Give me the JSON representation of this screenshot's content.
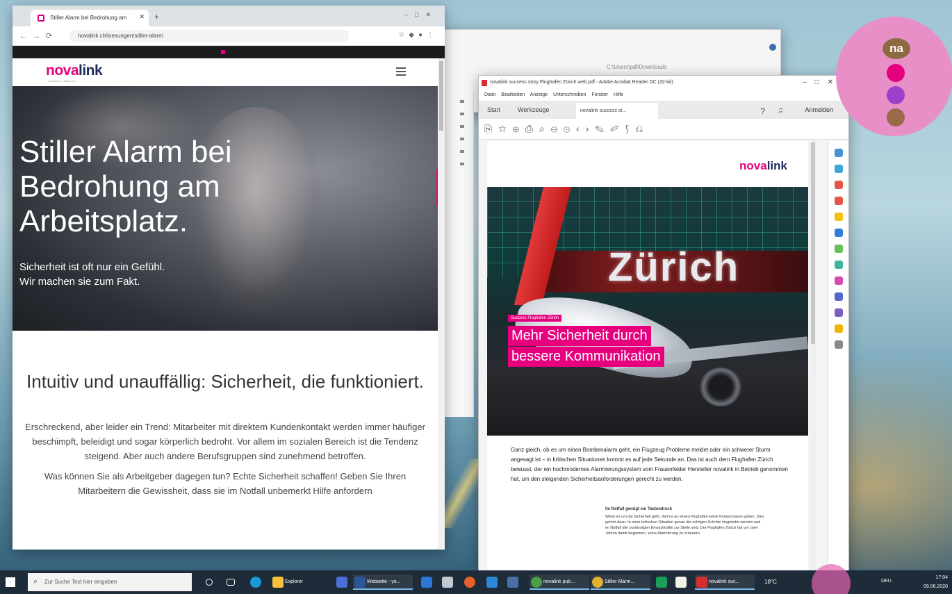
{
  "bg_window": {
    "address": "C:\\Users\\pdf\\Downloads"
  },
  "browser": {
    "tab_title": "Stiller Alarm bei Bedrohung am",
    "url": "novalink.ch/loesungen/stiller-alarm",
    "logo_nova": "nova",
    "logo_link": "link",
    "logo_sub": "Kommunikation",
    "hero_title": "Stiller Alarm bei Bedrohung am Arbeitsplatz.",
    "hero_tagline_1": "Sicherheit ist oft nur ein Gefühl.",
    "hero_tagline_2": "Wir machen sie zum Fakt.",
    "section_heading": "Intuitiv und unauffällig: Sicherheit, die funktioniert.",
    "para_1": "Erschreckend, aber leider ein Trend: Mitarbeiter mit direktem Kundenkontakt werden immer häufiger beschimpft, beleidigt und sogar körperlich bedroht. Vor allem im sozialen Bereich ist die Tendenz steigend. Aber auch andere Berufsgruppen sind zunehmend betroffen.",
    "para_2": "Was können Sie als Arbeitgeber dagegen tun? Echte Sicherheit schaffen! Geben Sie Ihren Mitarbeitern die Gewissheit, dass sie im Notfall unbemerkt Hilfe anfordern"
  },
  "pdf": {
    "window_title": "novalink success story Flughafen Zürich web.pdf - Adobe Acrobat Reader DC (32-bit)",
    "menu": "Datei Bearbeiten Anzeige Unterschreiben Fenster Hilfe",
    "tab_start": "Start",
    "tab_tools": "Werkzeuge",
    "tab_doc": "novalink success st...",
    "signin": "Anmelden",
    "logo_nova": "nova",
    "logo_link": "link",
    "photo_text": "Zürich",
    "kicker": "Success Flughafen Zürich",
    "headline_1": "Mehr Sicherheit durch",
    "headline_2": "bessere Kommunikation",
    "body": "Ganz gleich, ob es um einen Bombenalarm geht, ein Flugzeug Probleme meldet oder ein schwerer Sturm angesagt ist – in kritischen Situationen kommt es auf jede Sekunde an. Das ist auch dem Flughafen Zürich bewusst, der ein hochmodernes Alarmierungssystem vom Frauenfelder Hersteller novalink in Betrieb genommen hat, um den steigenden Sicherheitsanforderungen gerecht zu werden.",
    "col_heading": "Im Notfall genügt ein Tastendruck",
    "col_text": "Wenn es um die Sicherheit geht, darf es an einem Flughafen keine Kompromisse geben. Dies gehört dazu: In einer kritischen Situation genau die richtigen Schritte eingeleitet werden und im Notfall alle zuständigen Einsatzkräfte zur Stelle sind. Der Flughafen Zürich hat vor zwei Jahren damit begonnen, seine Alarmierung zu erneuern."
  },
  "overlay": {
    "logo": "na"
  },
  "taskbar": {
    "search_placeholder": "Zur Suche Text hier eingeben",
    "explorer": "Explorer",
    "item_1": "Webseite - yo...",
    "item_2": "novalink pub...",
    "item_3": "Stiller Alarm...",
    "item_4": "novalink suc...",
    "tray_lang": "DEU",
    "tray_time": "17:04",
    "tray_date": "09.06.2020",
    "tray_temp": "18°C"
  },
  "colors": {
    "brand_pink": "#e6007e",
    "brand_navy": "#1f2b5a",
    "taskbar": "#1e2b38"
  }
}
